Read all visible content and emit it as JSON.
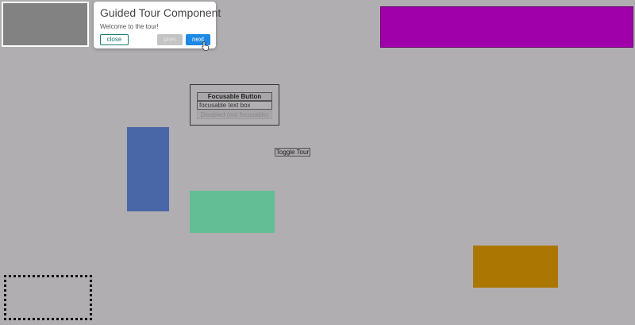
{
  "tour": {
    "title": "Guided Tour Component",
    "text": "Welcome to the tour!",
    "close_label": "close",
    "prev_label": "prev",
    "next_label": "next"
  },
  "focus_group": {
    "button_label": "Focusable Button",
    "input_value": "focusable text box",
    "disabled_label": "Disabled (not focusable)"
  },
  "toggle_label": "Toggle Tour",
  "colors": {
    "background": "#b0aeb0",
    "magenta_block": "#a000aa",
    "blue_block": "#4967a6",
    "green_block": "#63bd95",
    "orange_block": "#ac7603",
    "next_button": "#1e88e5",
    "close_button_border": "#1e7a72"
  },
  "icons": {
    "cursor": "hand-pointer-icon"
  }
}
